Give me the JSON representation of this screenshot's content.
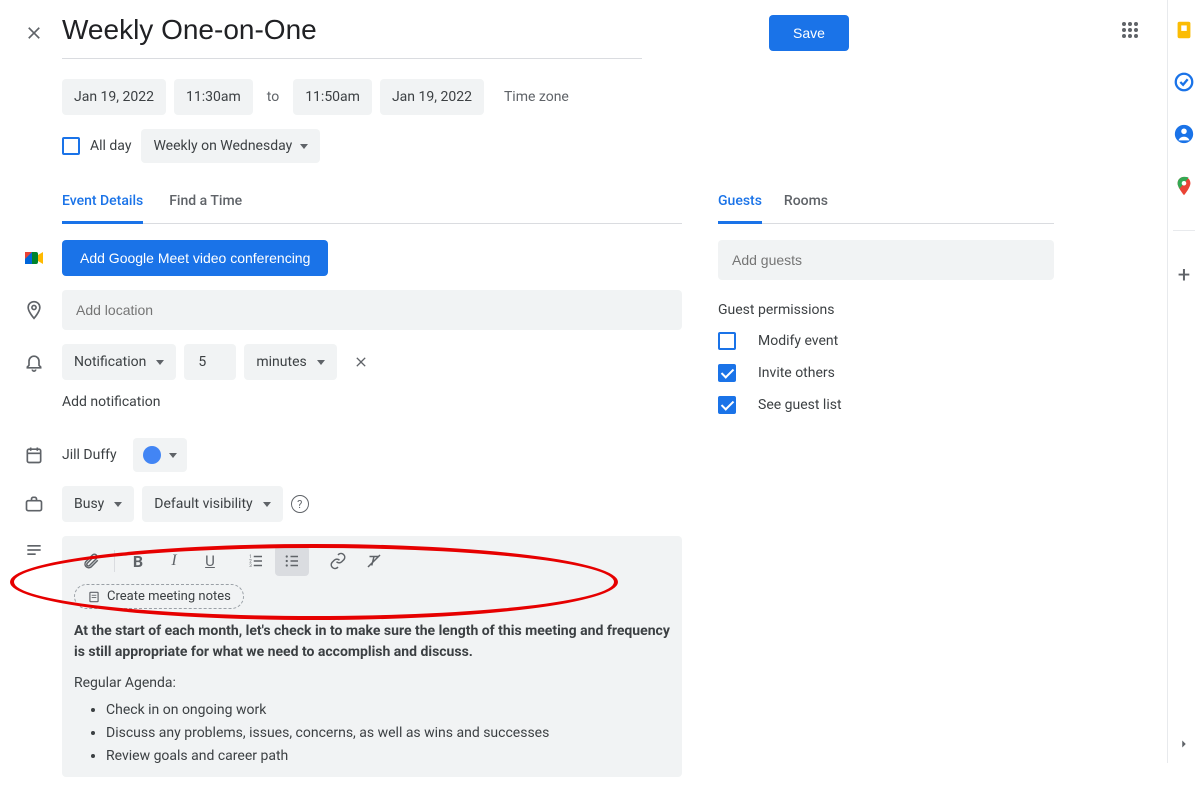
{
  "header": {
    "title": "Weekly One-on-One",
    "save_label": "Save"
  },
  "datetime": {
    "start_date": "Jan 19, 2022",
    "start_time": "11:30am",
    "to_label": "to",
    "end_time": "11:50am",
    "end_date": "Jan 19, 2022",
    "timezone_label": "Time zone"
  },
  "allday": {
    "label": "All day",
    "recurrence": "Weekly on Wednesday"
  },
  "tabs_left": {
    "details": "Event Details",
    "findtime": "Find a Time"
  },
  "meet_button": "Add Google Meet video conferencing",
  "location_placeholder": "Add location",
  "notification": {
    "type": "Notification",
    "value": "5",
    "unit": "minutes"
  },
  "add_notification": "Add notification",
  "owner": "Jill Duffy",
  "availability": {
    "busy": "Busy",
    "visibility": "Default visibility"
  },
  "editor": {
    "create_notes": "Create meeting notes",
    "bold_text": "At the start of each month, let's check in to make sure the length of this meeting and frequency is still appropriate for what we need to accomplish and discuss.",
    "agenda_label": "Regular Agenda:",
    "agenda_items": [
      "Check in on ongoing work",
      "Discuss any problems, issues, concerns, as well as wins and successes",
      "Review goals and career path"
    ]
  },
  "tabs_right": {
    "guests": "Guests",
    "rooms": "Rooms"
  },
  "guests_placeholder": "Add guests",
  "permissions": {
    "title": "Guest permissions",
    "modify": "Modify event",
    "invite": "Invite others",
    "seelist": "See guest list"
  }
}
